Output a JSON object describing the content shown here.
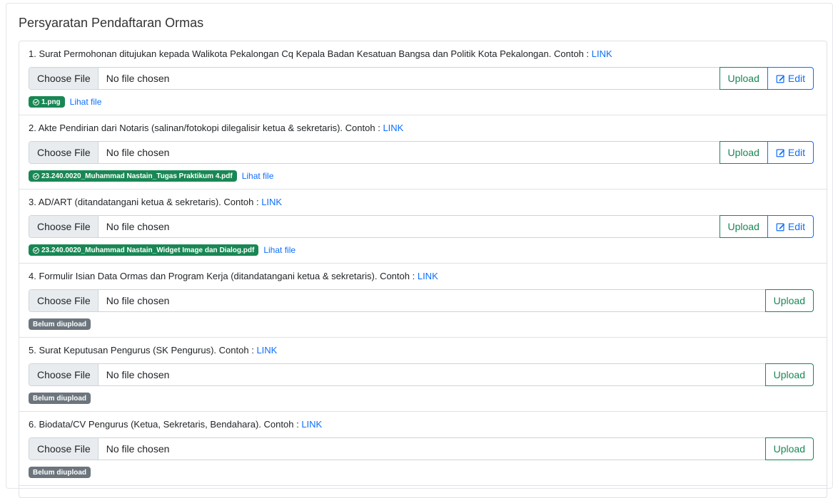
{
  "page": {
    "title": "Persyaratan Pendaftaran Ormas"
  },
  "common": {
    "choose_file": "Choose File",
    "no_file": "No file chosen",
    "upload": "Upload",
    "edit": "Edit",
    "view_file": "Lihat file",
    "not_uploaded": "Belum diupload",
    "link_label": "LINK",
    "example_prefix": "Contoh :"
  },
  "items": [
    {
      "label": "1. Surat Permohonan ditujukan kepada Walikota Pekalongan Cq Kepala Badan Kesatuan Bangsa dan Politik Kota Pekalongan.",
      "uploaded": true,
      "file_name": "1.png"
    },
    {
      "label": "2. Akte Pendirian dari Notaris (salinan/fotokopi dilegalisir ketua & sekretaris).",
      "uploaded": true,
      "file_name": "23.240.0020_Muhammad Nastain_Tugas Praktikum 4.pdf"
    },
    {
      "label": "3. AD/ART (ditandatangani ketua & sekretaris).",
      "uploaded": true,
      "file_name": "23.240.0020_Muhammad Nastain_Widget Image dan Dialog.pdf"
    },
    {
      "label": "4. Formulir Isian Data Ormas dan Program Kerja (ditandatangani ketua & sekretaris).",
      "uploaded": false
    },
    {
      "label": "5. Surat Keputusan Pengurus (SK Pengurus).",
      "uploaded": false
    },
    {
      "label": "6. Biodata/CV Pengurus (Ketua, Sekretaris, Bendahara).",
      "uploaded": false
    }
  ],
  "colors": {
    "success": "#198754",
    "primary": "#0d6efd",
    "secondary": "#6c757d"
  }
}
